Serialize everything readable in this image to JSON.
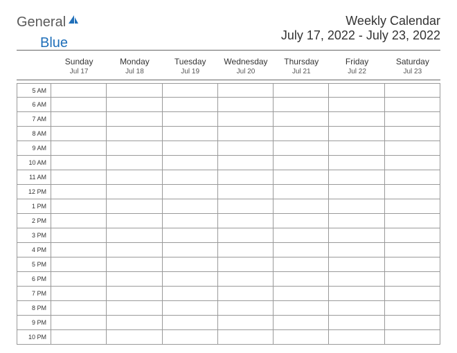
{
  "logo": {
    "part1": "General",
    "part2": "Blue"
  },
  "title": "Weekly Calendar",
  "daterange": "July 17, 2022 - July 23, 2022",
  "days": [
    {
      "name": "Sunday",
      "date": "Jul 17"
    },
    {
      "name": "Monday",
      "date": "Jul 18"
    },
    {
      "name": "Tuesday",
      "date": "Jul 19"
    },
    {
      "name": "Wednesday",
      "date": "Jul 20"
    },
    {
      "name": "Thursday",
      "date": "Jul 21"
    },
    {
      "name": "Friday",
      "date": "Jul 22"
    },
    {
      "name": "Saturday",
      "date": "Jul 23"
    }
  ],
  "hours": [
    "5 AM",
    "6 AM",
    "7 AM",
    "8 AM",
    "9 AM",
    "10 AM",
    "11 AM",
    "12 PM",
    "1 PM",
    "2 PM",
    "3 PM",
    "4 PM",
    "5 PM",
    "6 PM",
    "7 PM",
    "8 PM",
    "9 PM",
    "10 PM"
  ]
}
